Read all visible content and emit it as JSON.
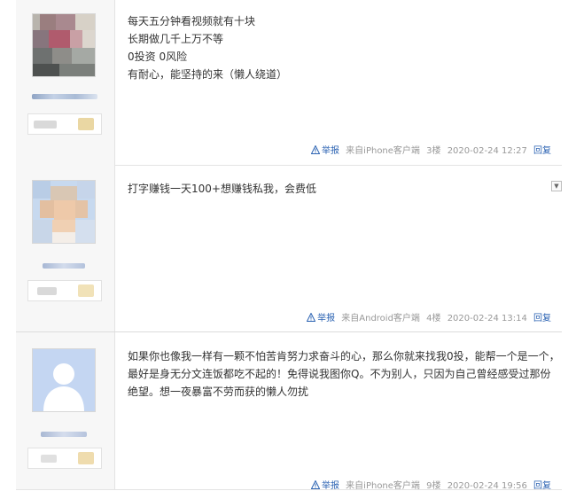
{
  "posts": [
    {
      "floor": "3楼",
      "source": "来自iPhone客户端",
      "time": "2020-02-24 12:27",
      "report": "举报",
      "reply": "回复",
      "content": [
        "每天五分钟看视频就有十块",
        "长期做几千上万不等",
        "0投资 0风险",
        "有耐心，能坚持的来（懒人绕道）"
      ]
    },
    {
      "floor": "4楼",
      "source": "来自Android客户端",
      "time": "2020-02-24 13:14",
      "report": "举报",
      "reply": "回复",
      "content": [
        "打字赚钱一天100+想赚钱私我，会费低"
      ]
    },
    {
      "floor": "9楼",
      "source": "来自iPhone客户端",
      "time": "2020-02-24 19:56",
      "report": "举报",
      "reply": "回复",
      "content": [
        "如果你也像我一样有一颗不怕苦肯努力求奋斗的心，那么你就来找我0投，能帮一个是一个，",
        "最好是身无分文连饭都吃不起的！免得说我图你Q。不为别人，只因为自己曾经感受过那份",
        "绝望。想一夜暴富不劳而获的懒人勿扰"
      ]
    }
  ],
  "colors": {
    "link": "#2d64b3",
    "meta": "#999999",
    "sidebar_bg": "#f7f7f7"
  },
  "icons": {
    "report": "warning-triangle-icon",
    "expand": "chevron-down-icon"
  }
}
